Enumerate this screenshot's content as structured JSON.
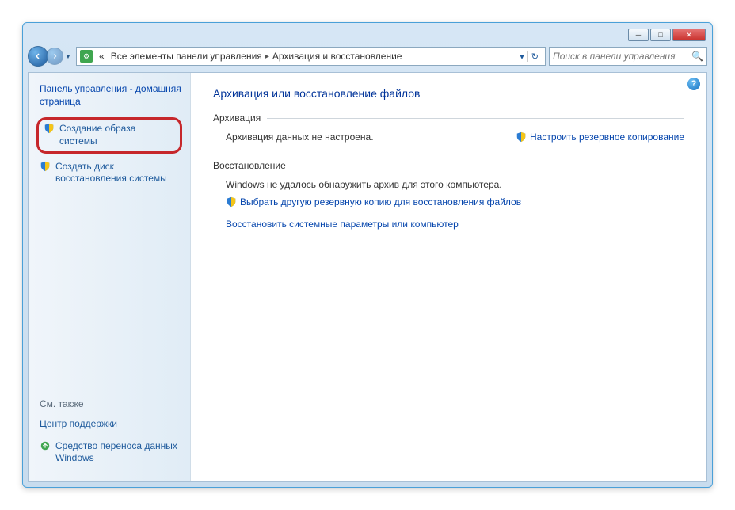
{
  "breadcrumb": {
    "prefix": "«",
    "seg1": "Все элементы панели управления",
    "seg2": "Архивация и восстановление"
  },
  "search": {
    "placeholder": "Поиск в панели управления"
  },
  "sidebar": {
    "home": "Панель управления - домашняя страница",
    "link_create_image": "Создание образа системы",
    "link_create_disc": "Создать диск восстановления системы",
    "see_also": "См. также",
    "link_support": "Центр поддержки",
    "link_transfer": "Средство переноса данных Windows"
  },
  "main": {
    "heading": "Архивация или восстановление файлов",
    "backup_title": "Архивация",
    "backup_text": "Архивация данных не настроена.",
    "backup_link": "Настроить резервное копирование",
    "restore_title": "Восстановление",
    "restore_text": "Windows не удалось обнаружить архив для этого компьютера.",
    "restore_link1": "Выбрать другую резервную копию для восстановления файлов",
    "restore_link2": "Восстановить системные параметры или компьютер"
  }
}
